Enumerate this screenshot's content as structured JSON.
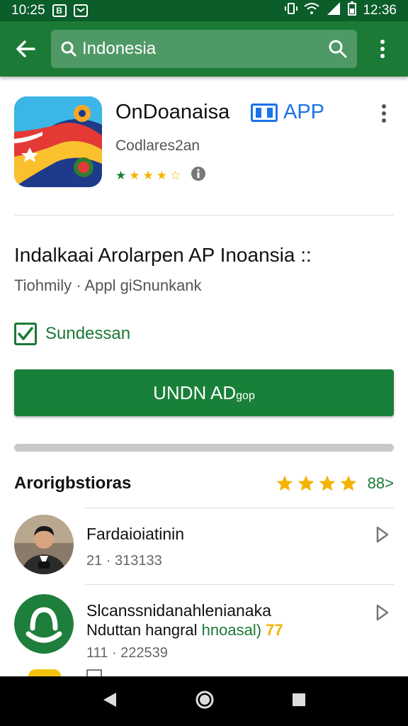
{
  "status_bar": {
    "time_left": "10:25",
    "time_right": "12:36"
  },
  "search": {
    "query": "Indonesia"
  },
  "app": {
    "title": "OnDoanaisa",
    "tag": "APP",
    "developer": "Codlares2an",
    "rating_stars": 4.5
  },
  "details": {
    "headline": "Indalkaai Arolarpen AP Inoansia ::",
    "subline": "Tiohmily · Appl giSnunkank",
    "checkbox_label": "Sundessan"
  },
  "install": {
    "label": "UNDN AD",
    "label_suffix": "gop"
  },
  "progress": {
    "fraction": 1.0
  },
  "reviews": {
    "title": "Arorigbstioras",
    "stars": 4,
    "count_link": "88>",
    "items": [
      {
        "name": "Fardaioiatinin",
        "meta": "21 · 313133"
      },
      {
        "name": "Slcanssnidanahlenianaka",
        "text_a": "Nduttan hangral ",
        "text_b": "hnoasal)",
        "text_c": " 77",
        "meta": "111 · 222539"
      }
    ]
  },
  "colors": {
    "brand": "#1b7a35",
    "status": "#0b5d2a",
    "star": "#f4b400",
    "link": "#1a73e8"
  }
}
